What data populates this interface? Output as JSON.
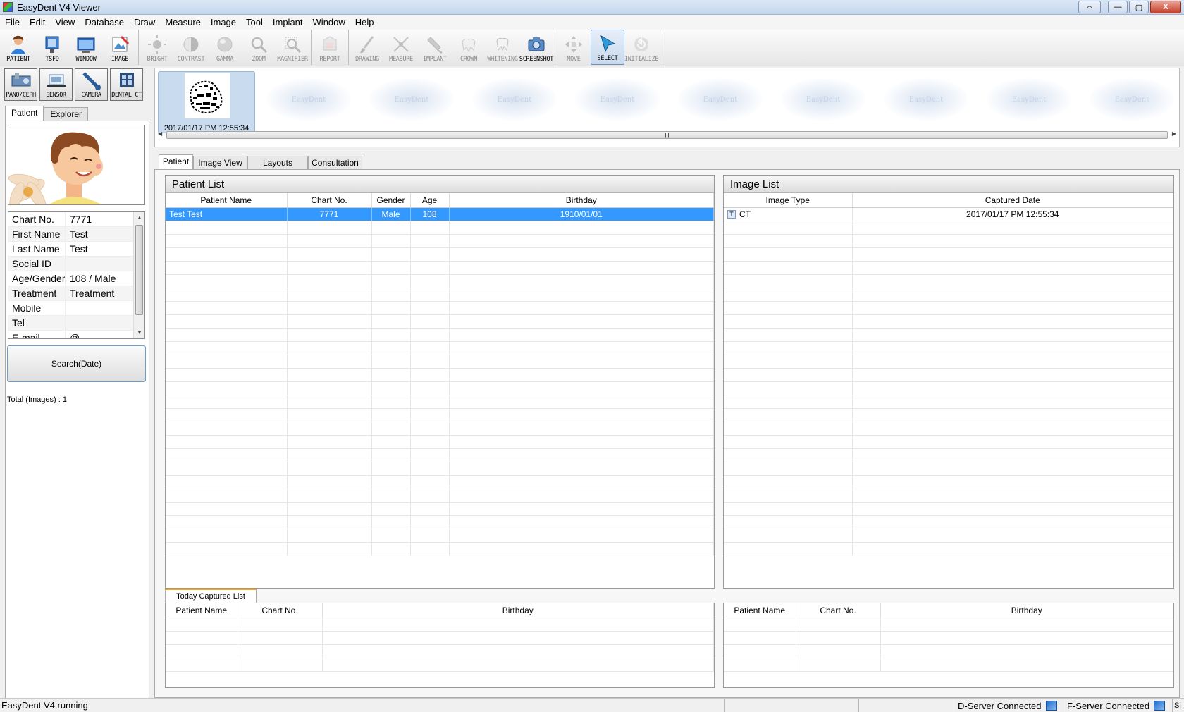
{
  "window": {
    "title": "EasyDent V4 Viewer",
    "controls": {
      "extra": "⇔",
      "minimize": "—",
      "maximize": "▢",
      "close": "X"
    }
  },
  "menu": [
    "File",
    "Edit",
    "View",
    "Database",
    "Draw",
    "Measure",
    "Image",
    "Tool",
    "Implant",
    "Window",
    "Help"
  ],
  "toolbar": {
    "groups": [
      [
        {
          "label": "PATIENT",
          "icon": "patient-icon"
        },
        {
          "label": "TSFD",
          "icon": "monitor-icon"
        },
        {
          "label": "WINDOW",
          "icon": "window-icon"
        },
        {
          "label": "IMAGE",
          "icon": "image-icon"
        }
      ],
      [
        {
          "label": "BRIGHT",
          "icon": "sun-icon"
        },
        {
          "label": "CONTRAST",
          "icon": "contrast-icon"
        },
        {
          "label": "GAMMA",
          "icon": "gamma-icon"
        },
        {
          "label": "ZOOM",
          "icon": "zoom-icon"
        },
        {
          "label": "MAGNIFIER",
          "icon": "magnifier-icon"
        }
      ],
      [
        {
          "label": "REPORT",
          "icon": "report-icon"
        }
      ],
      [
        {
          "label": "DRAWING",
          "icon": "brush-icon"
        },
        {
          "label": "MEASURE",
          "icon": "measure-icon"
        },
        {
          "label": "IMPLANT",
          "icon": "implant-icon"
        },
        {
          "label": "CROWN",
          "icon": "crown-icon"
        },
        {
          "label": "WHITENING",
          "icon": "tooth-icon"
        },
        {
          "label": "SCREENSHOT",
          "icon": "camera-icon"
        }
      ],
      [
        {
          "label": "MOVE",
          "icon": "move-icon"
        },
        {
          "label": "SELECT",
          "icon": "cursor-icon"
        },
        {
          "label": "INITIALIZE",
          "icon": "reset-icon"
        }
      ]
    ],
    "dimmed": [
      "BRIGHT",
      "CONTRAST",
      "GAMMA",
      "ZOOM",
      "MAGNIFIER",
      "REPORT",
      "DRAWING",
      "MEASURE",
      "IMPLANT",
      "CROWN",
      "WHITENING",
      "MOVE",
      "INITIALIZE"
    ],
    "active": "SELECT"
  },
  "acquisition": [
    {
      "label": "PANO/CEPH"
    },
    {
      "label": "SENSOR"
    },
    {
      "label": "CAMERA"
    },
    {
      "label": "DENTAL CT"
    }
  ],
  "left_tabs": [
    "Patient",
    "Explorer"
  ],
  "patient_info": [
    {
      "key": "Chart No.",
      "value": "7771"
    },
    {
      "key": "First Name",
      "value": "Test"
    },
    {
      "key": "Last Name",
      "value": "Test"
    },
    {
      "key": "Social ID",
      "value": ""
    },
    {
      "key": "Age/Gender",
      "value": "108 / Male"
    },
    {
      "key": "Treatment",
      "value": "Treatment"
    },
    {
      "key": "Mobile",
      "value": ""
    },
    {
      "key": "Tel",
      "value": ""
    },
    {
      "key": "E-mail",
      "value": "@"
    }
  ],
  "search_button": "Search(Date)",
  "total_images": "Total (Images) : 1",
  "thumbnail": {
    "date": "2017/01/17 PM 12:55:34",
    "placeholder_text": "EasyDent"
  },
  "main_tabs": [
    "Patient",
    "Image View",
    "Layouts",
    "Consultation"
  ],
  "patient_list": {
    "title": "Patient List",
    "columns": [
      "Patient Name",
      "Chart No.",
      "Gender",
      "Age",
      "Birthday"
    ],
    "rows": [
      [
        "Test Test",
        "7771",
        "Male",
        "108",
        "1910/01/01"
      ]
    ]
  },
  "image_list": {
    "title": "Image List",
    "columns": [
      "Image Type",
      "Captured Date"
    ],
    "rows": [
      [
        "CT",
        "2017/01/17 PM 12:55:34"
      ]
    ]
  },
  "today_tab": "Today Captured List",
  "today_left": {
    "columns": [
      "Patient Name",
      "Chart No.",
      "Birthday"
    ]
  },
  "today_right": {
    "columns": [
      "Patient Name",
      "Chart No.",
      "Birthday"
    ]
  },
  "status": {
    "left": "EasyDent V4 running",
    "dserver": "D-Server Connected",
    "fserver": "F-Server Connected",
    "tail": "Si"
  },
  "colors": {
    "selection": "#3399ff",
    "accent_tab": "#f5a623"
  }
}
